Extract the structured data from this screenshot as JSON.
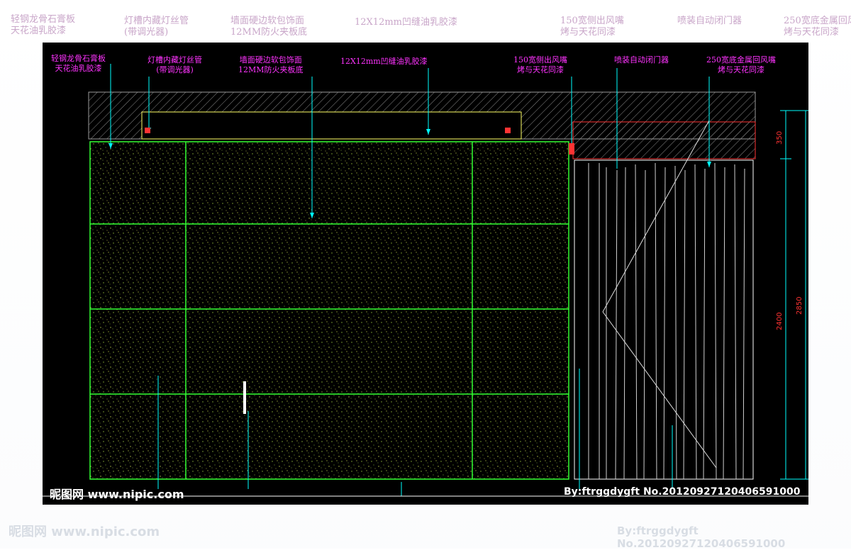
{
  "labels": [
    "轻钢龙骨石膏板\n天花油乳胶漆",
    "灯槽内藏灯丝管\n(带调光器)",
    "墙面硬边软包饰面\n12MM防火夹板底",
    "12X12mm凹缝油乳胶漆",
    "150宽侧出风嘴\n烤与天花同漆",
    "喷装自动闭门器",
    "250宽底金属回风嘴\n烤与天花同漆"
  ],
  "dimensions": {
    "d350": "350",
    "d2400": "2400",
    "d2850": "2850"
  },
  "watermark_left": "昵图网 www.nipic.com",
  "watermark_right": "By:ftrggdygft  No.20120927120406591000",
  "colors": {
    "label": "#ff33ff",
    "grid": "#33ff33",
    "leader": "#00ffff",
    "dim": "#ff3333",
    "hatch": "#888888",
    "outline": "#ffff66"
  }
}
